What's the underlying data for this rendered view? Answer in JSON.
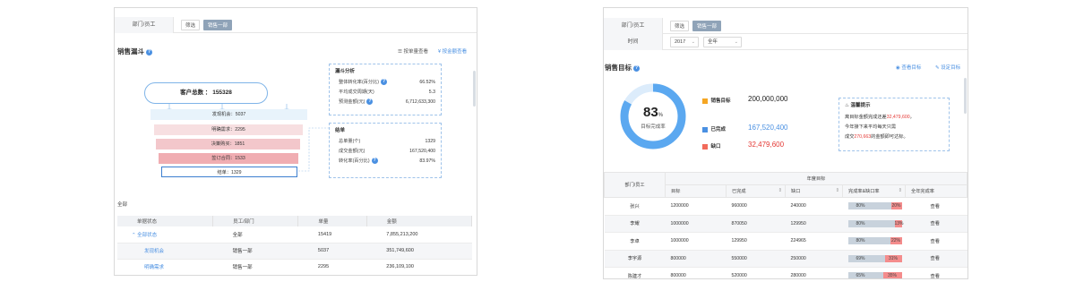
{
  "left": {
    "filter": {
      "label": "部门/员工",
      "filter_chip": "筛选",
      "active_chip": "销售一部"
    },
    "title": "销售漏斗",
    "help": "?",
    "links": {
      "by_count": "按单量查看",
      "by_amount": "按金额查看"
    },
    "funnel": {
      "customer_total_label": "客户总数",
      "customer_total_value": "155328",
      "stages": [
        {
          "label": "发现机会：5037",
          "color": "#e8f3fb"
        },
        {
          "label": "明确需求：2295",
          "color": "#f7dfe1"
        },
        {
          "label": "决策购买：1851",
          "color": "#f3c7cb"
        },
        {
          "label": "签订合同：1533",
          "color": "#f0adb2"
        },
        {
          "label": "结单：1329",
          "color": "#ffffff"
        }
      ]
    },
    "analysis": {
      "title": "漏斗分析",
      "rows": [
        {
          "k": "整体转化率(百分比)",
          "v": "66.52%",
          "help": true
        },
        {
          "k": "平均成交周期(天)",
          "v": "5.3",
          "help": false
        },
        {
          "k": "预测金额(元)",
          "v": "6,712,633,300",
          "help": true
        }
      ]
    },
    "closed": {
      "title": "结单",
      "rows": [
        {
          "k": "总单量(个)",
          "v": "1329",
          "help": false
        },
        {
          "k": "成交金额(元)",
          "v": "167,520,400",
          "help": false
        },
        {
          "k": "转化率(百分比)",
          "v": "83.97%",
          "help": true
        }
      ]
    },
    "table_caption": "全部",
    "table": {
      "headers": [
        "单据状态",
        "员工/部门",
        "单量",
        "金额"
      ],
      "rows": [
        [
          "全部状态",
          "全部",
          "15419",
          "7,855,213,200"
        ],
        [
          "发现机会",
          "销售一部",
          "5037",
          "351,749,600"
        ],
        [
          "明确需求",
          "销售一部",
          "2295",
          "236,109,100"
        ]
      ]
    }
  },
  "right": {
    "filter": {
      "label": "部门/员工",
      "filter_chip": "筛选",
      "active_chip": "销售一部"
    },
    "time": {
      "label": "时间",
      "year": "2017",
      "period": "全年"
    },
    "title": "销售目标",
    "help": "?",
    "links": {
      "view": "查看目标",
      "set": "设定目标"
    },
    "ring": {
      "value": "83",
      "unit": "%",
      "caption": "目标完成率",
      "progress": 0.83,
      "color_done": "#5ba8f0",
      "color_track": "#dcecfb"
    },
    "legend": [
      {
        "name": "销售目标",
        "value": "200,000,000",
        "color": "#f5a623",
        "value_color": "#222"
      },
      {
        "name": "已完成",
        "value": "167,520,400",
        "color": "#4a90e2",
        "value_color": "#4a90e2"
      },
      {
        "name": "缺口",
        "value": "32,479,600",
        "color": "#f26b5b",
        "value_color": "#e53935"
      }
    ],
    "tip": {
      "title": "温馨提示",
      "line1_pre": "离目标金额完成还差",
      "line1_val": "32,479,600",
      "line1_post": "，",
      "line2": "今年接下来平均每天只需",
      "line3_pre": "成交",
      "line3_val": "270,663",
      "line3_post": "的金额即可达标。"
    },
    "table": {
      "group_header": "年度目标",
      "first_header": "部门/员工",
      "headers": [
        "目标",
        "已完成",
        "缺口",
        "完成率&缺口率",
        "全年完成率"
      ],
      "rows": [
        {
          "name": "张兴",
          "target": "1200000",
          "done": "960000",
          "gap": "240000",
          "done_pct": "80%",
          "gap_pct": "20%",
          "done_ratio": 0.8,
          "action": "查看"
        },
        {
          "name": "李耀",
          "target": "1000000",
          "done": "870050",
          "gap": "129950",
          "done_pct": "80%",
          "gap_pct": "13%",
          "done_ratio": 0.87,
          "action": "查看"
        },
        {
          "name": "李卓",
          "target": "1000000",
          "done": "129950",
          "gap": "224965",
          "done_pct": "80%",
          "gap_pct": "22%",
          "done_ratio": 0.78,
          "action": "查看"
        },
        {
          "name": "李宇源",
          "target": "800000",
          "done": "550000",
          "gap": "250000",
          "done_pct": "69%",
          "gap_pct": "31%",
          "done_ratio": 0.69,
          "action": "查看"
        },
        {
          "name": "陈建才",
          "target": "800000",
          "done": "520000",
          "gap": "280000",
          "done_pct": "65%",
          "gap_pct": "35%",
          "done_ratio": 0.65,
          "action": "查看"
        }
      ]
    }
  }
}
